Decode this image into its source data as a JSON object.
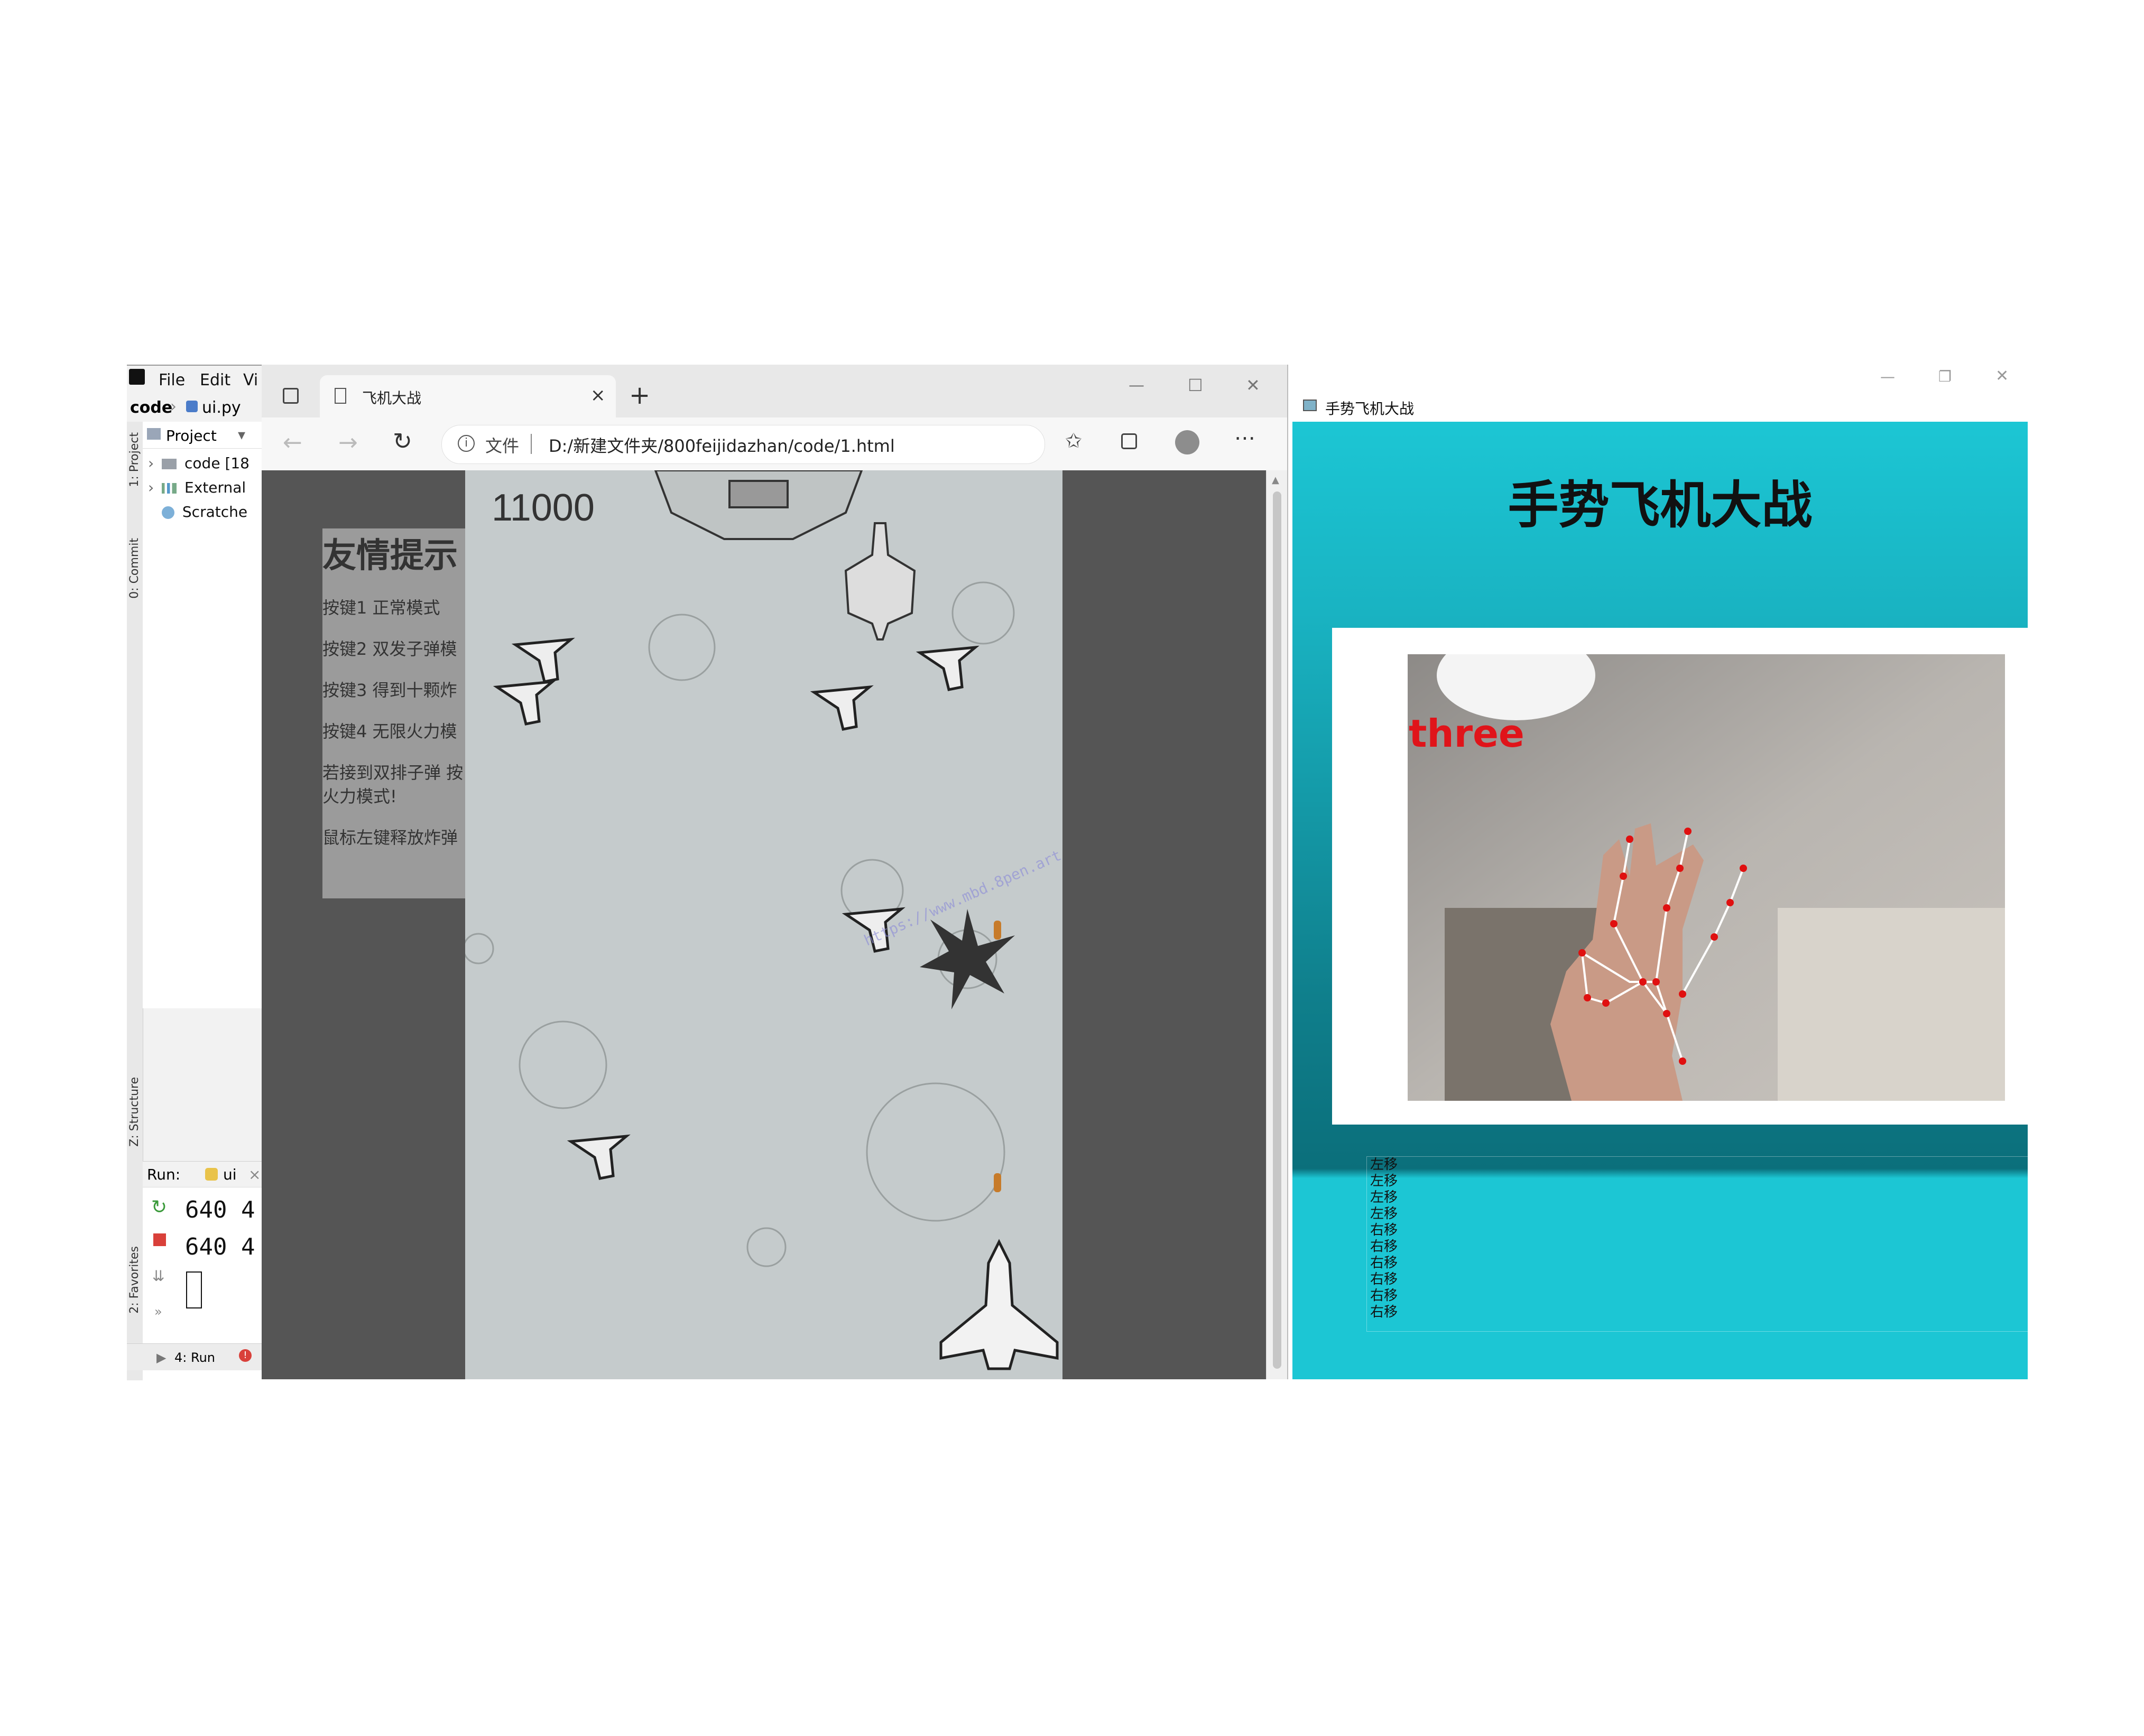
{
  "ide": {
    "menu": [
      "File",
      "Edit",
      "Vi"
    ],
    "breadcrumb": [
      "code",
      "ui.py"
    ],
    "tool_tabs": [
      "1: Project",
      "0: Commit",
      "Z: Structure",
      "2: Favorites"
    ],
    "project_header": "Project",
    "tree": [
      "code [18",
      "External",
      "Scratche"
    ],
    "run_label": "Run:",
    "run_config": "ui",
    "console_lines": [
      "640  4",
      "640  4"
    ],
    "status_tab": "4: Run"
  },
  "browser": {
    "tab_title": "飞机大战",
    "address_prefix": "文件",
    "url": "D:/新建文件夹/800feijidazhan/code/1.html",
    "window_controls": [
      "—",
      "☐",
      "✕"
    ]
  },
  "tips": {
    "heading": "友情提示",
    "lines": [
      "按键1 正常模式",
      "按键2 双发子弹模",
      "按键3 得到十颗炸",
      "按键4 无限火力模",
      "若接到双排子弹 按",
      "火力模式!",
      "鼠标左键释放炸弹"
    ]
  },
  "game": {
    "score": "11000",
    "watermark": "https://www.mbd.8pen.art/o/qunshan/w"
  },
  "gesture_app": {
    "window_title": "手势飞机大战",
    "heading": "手势飞机大战",
    "gesture_label": "three",
    "log": [
      "左移",
      "左移",
      "左移",
      "左移",
      "右移",
      "右移",
      "右移",
      "右移",
      "右移",
      "右移"
    ]
  },
  "colors": {
    "game_bg": "#c5cbcc",
    "page_bg": "#555555",
    "gesture_teal": "#14b8c9",
    "gesture_label": "#e0141a",
    "landmark": "#e01010"
  }
}
